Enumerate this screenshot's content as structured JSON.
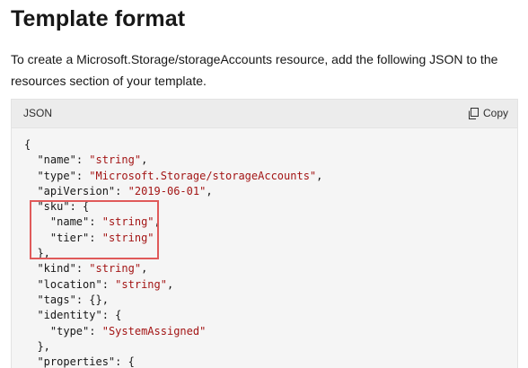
{
  "header": {
    "title": "Template format"
  },
  "intro": {
    "text": "To create a Microsoft.Storage/storageAccounts resource, add the following JSON to the resources section of your template."
  },
  "code_block": {
    "language_label": "JSON",
    "copy_label": "Copy",
    "copy_icon": "copy-icon",
    "highlight_color": "#e05a5a",
    "lines": [
      "{",
      "  \"name\": \"string\",",
      "  \"type\": \"Microsoft.Storage/storageAccounts\",",
      "  \"apiVersion\": \"2019-06-01\",",
      "  \"sku\": {",
      "    \"name\": \"string\",",
      "    \"tier\": \"string\"",
      "  },",
      "  \"kind\": \"string\",",
      "  \"location\": \"string\",",
      "  \"tags\": {},",
      "  \"identity\": {",
      "    \"type\": \"SystemAssigned\"",
      "  },",
      "  \"properties\": {"
    ]
  }
}
